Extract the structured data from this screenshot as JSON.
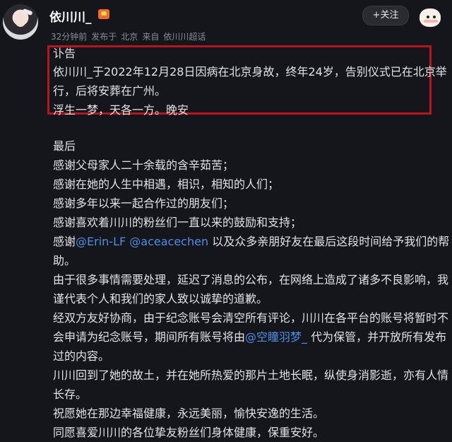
{
  "header": {
    "username": "依川川_",
    "follow_label": "+关注",
    "meta": {
      "time": "32分钟前",
      "location_prefix": "发布于",
      "location": "北京",
      "source_prefix": "来自",
      "source": "依川川超话"
    }
  },
  "notice": {
    "title": "讣告",
    "line1": "依川川_于2022年12月28日因病在北京身故，终年24岁，告别仪式已在北京举",
    "line2": "行，后将安葬在广州。",
    "line3": "浮生一梦，天各一方。晚安"
  },
  "body": {
    "heading": "最后",
    "l1": "感谢父母家人二十余载的含辛茹苦；",
    "l2": "感谢在她的人生中相遇，相识，相知的人们；",
    "l3": "感谢多年以来一起合作过的朋友们；",
    "l4": "感谢喜欢着川川的粉丝们一直以来的鼓励和支持；",
    "l5_prefix": "感谢",
    "mention1": "@Erin-LF",
    "mention2": "@aceacechen",
    "l5_suffix": "以及众多亲朋好友在最后这段时间给予我们的帮",
    "l6": "助。",
    "l7": "由于很多事情需要处理，延迟了消息的公布，在网络上造成了诸多不良影响，我",
    "l8": "谨代表个人和我们的家人致以诚挚的道歉。",
    "l9": "经双方友好协商，由于纪念账号会清空所有评论，川川在各平台的账号将暂时不",
    "l10_prefix": "会申请为纪念账号，期间所有账号将由",
    "mention3": "@空瞳羽梦_",
    "l10_suffix": "代为保管，并开放所有发布",
    "l11": "过的内容。",
    "l12": "川川回到了她的故土，并在她所热爱的那片土地长眠，纵使身消影逝，亦有人情",
    "l13": "长存。",
    "l14": "祝愿她在那边幸福健康，永远美丽，愉快安逸的生活。",
    "l15": "同愿喜爱川川的各位挚友粉丝们身体健康，保重安好。"
  },
  "colors": {
    "background": "#15161b",
    "notice_border": "#b8161d",
    "mention": "#4a8fe8"
  }
}
